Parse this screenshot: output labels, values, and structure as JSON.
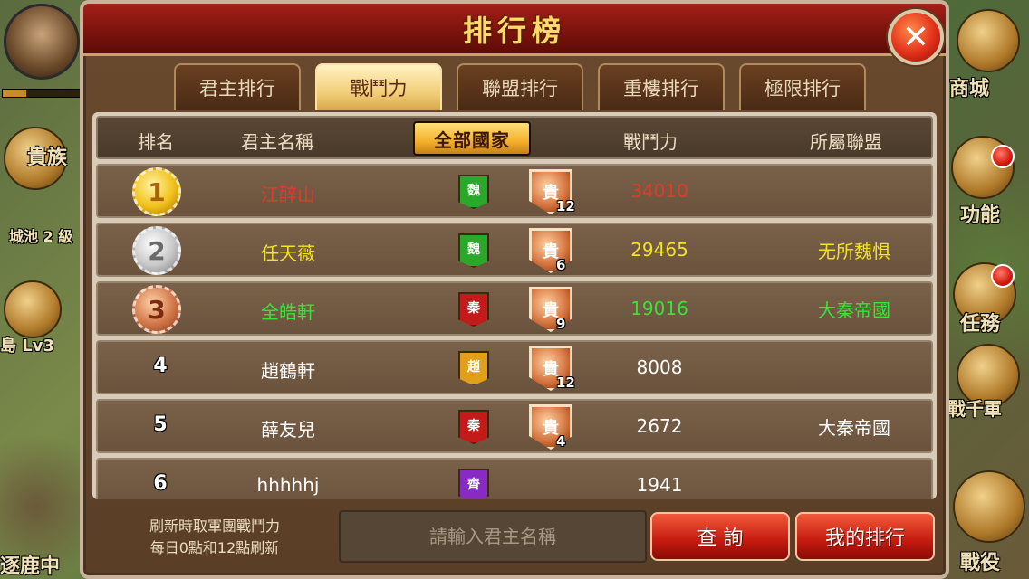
{
  "title": "排行榜",
  "tabs": [
    {
      "label": "君主排行",
      "active": false
    },
    {
      "label": "戰鬥力",
      "active": true
    },
    {
      "label": "聯盟排行",
      "active": false
    },
    {
      "label": "重樓排行",
      "active": false
    },
    {
      "label": "極限排行",
      "active": false
    }
  ],
  "table": {
    "headers": {
      "rank": "排名",
      "name": "君主名稱",
      "filter": "全部國家",
      "power": "戰鬥力",
      "alliance": "所屬聯盟"
    },
    "rows": [
      {
        "rank": "1",
        "name": "江醉山",
        "country": "魏",
        "vip": "貴",
        "vip_level": "12",
        "power": "34010",
        "alliance": "",
        "color": "#e23a2a"
      },
      {
        "rank": "2",
        "name": "任天薇",
        "country": "魏",
        "vip": "貴",
        "vip_level": "6",
        "power": "29465",
        "alliance": "无所魏惧",
        "color": "#f2e22a"
      },
      {
        "rank": "3",
        "name": "全皓軒",
        "country": "秦",
        "vip": "貴",
        "vip_level": "9",
        "power": "19016",
        "alliance": "大秦帝國",
        "color": "#3ae23a"
      },
      {
        "rank": "4",
        "name": "趙鶴軒",
        "country": "趙",
        "vip": "貴",
        "vip_level": "12",
        "power": "8008",
        "alliance": "",
        "color": "#ffffff"
      },
      {
        "rank": "5",
        "name": "薛友兒",
        "country": "秦",
        "vip": "貴",
        "vip_level": "4",
        "power": "2672",
        "alliance": "大秦帝國",
        "color": "#ffffff"
      },
      {
        "rank": "6",
        "name": "hhhhhj",
        "country": "齊",
        "vip": "",
        "vip_level": "",
        "power": "1941",
        "alliance": "",
        "color": "#ffffff"
      }
    ]
  },
  "footer": {
    "note_line1": "刷新時取軍團戰鬥力",
    "note_line2": "每日0點和12點刷新",
    "search_placeholder": "請輸入君主名稱",
    "query_button": "查 詢",
    "my_rank_button": "我的排行"
  },
  "side": {
    "left_labels": [
      "貴族",
      "城池 2 級",
      "島 Lv3",
      "逐鹿中"
    ],
    "right_labels": [
      "商城",
      "功能",
      "任務",
      "戰千軍",
      "戰役"
    ]
  },
  "colors": {
    "country_wei": "#2aa82a",
    "country_qin": "#c41a1a",
    "country_zhao": "#e2a01a",
    "country_qi": "#8a2ac4"
  }
}
